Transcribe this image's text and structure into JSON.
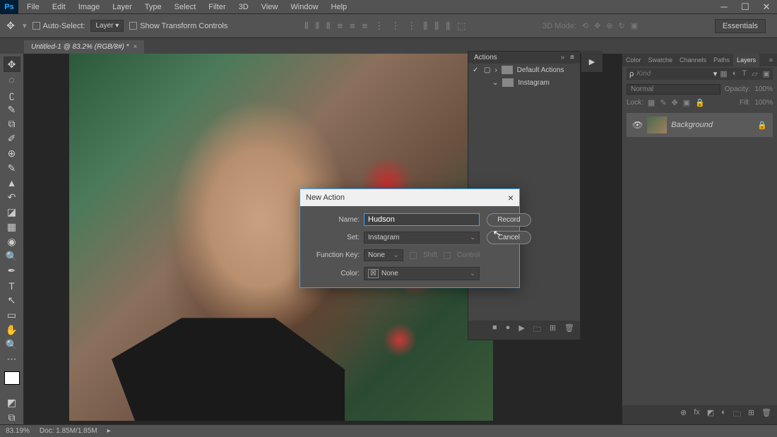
{
  "menubar": {
    "items": [
      "File",
      "Edit",
      "Image",
      "Layer",
      "Type",
      "Select",
      "Filter",
      "3D",
      "View",
      "Window",
      "Help"
    ]
  },
  "options": {
    "auto_select": "Auto-Select:",
    "layer_dd": "Layer",
    "show_transform": "Show Transform Controls",
    "mode_label": "3D Mode:",
    "workspace": "Essentials"
  },
  "doc": {
    "tab": "Untitled-1 @ 83.2% (RGB/8#) *",
    "close": "×"
  },
  "actions": {
    "title": "Actions",
    "default": "Default Actions",
    "set": "Instagram"
  },
  "right_tabs": [
    "Color",
    "Swatche",
    "Channels",
    "Paths",
    "Layers"
  ],
  "layers": {
    "kind": "Kind",
    "blend": "Normal",
    "opacity_lbl": "Opacity:",
    "opacity": "100%",
    "lock": "Lock:",
    "fill_lbl": "Fill:",
    "fill": "100%",
    "bg": "Background"
  },
  "status": {
    "zoom": "83.19%",
    "doc": "Doc: 1.85M/1.85M"
  },
  "dialog": {
    "title": "New Action",
    "close": "×",
    "name_lbl": "Name:",
    "name_val": "Hudson",
    "set_lbl": "Set:",
    "set_val": "Instagram",
    "fkey_lbl": "Function Key:",
    "fkey_val": "None",
    "shift": "Shift",
    "ctrl": "Control",
    "color_lbl": "Color:",
    "color_val": "None",
    "record": "Record",
    "cancel": "Cancel"
  }
}
